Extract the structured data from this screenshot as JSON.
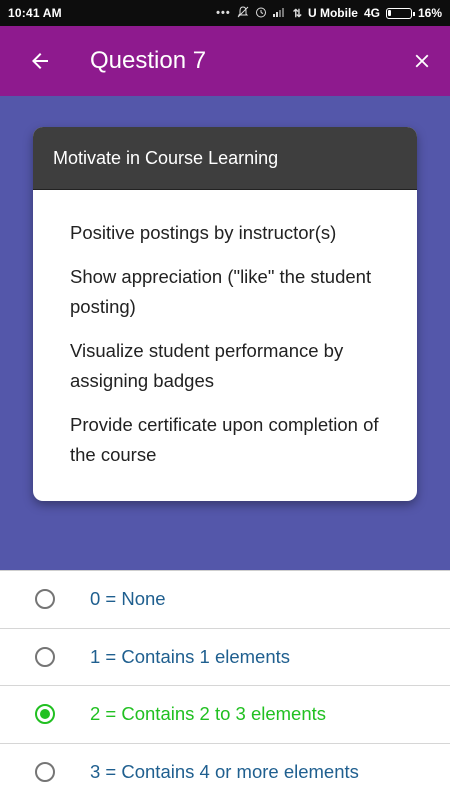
{
  "status_bar": {
    "time": "10:41 AM",
    "carrier": "U Mobile",
    "network": "4G",
    "battery": "16%",
    "battery_level": 0.16,
    "icons": [
      "dots-icon",
      "notifications-off-icon",
      "alarm-icon",
      "signal-icon",
      "data-transfer-icon",
      "battery-icon"
    ]
  },
  "app_bar": {
    "title": "Question 7",
    "background": "#8e1a8e",
    "back_icon": "arrow-left-icon",
    "close_icon": "close-icon"
  },
  "card": {
    "header": "Motivate in Course Learning",
    "items": [
      "Positive postings by instructor(s)",
      "Show appreciation (\"like\" the student posting)",
      "Visualize student performance by assigning badges",
      "Provide certificate upon completion of the course"
    ]
  },
  "hero_background": "#5457aa",
  "options": [
    {
      "label": "0 = None",
      "selected": false
    },
    {
      "label": "1 = Contains 1 elements",
      "selected": false
    },
    {
      "label": "2 = Contains 2 to 3 elements",
      "selected": true
    },
    {
      "label": "3 = Contains 4 or more elements",
      "selected": false
    }
  ],
  "colors": {
    "selected": "#21c021",
    "option_text": "#1f5f8f"
  }
}
